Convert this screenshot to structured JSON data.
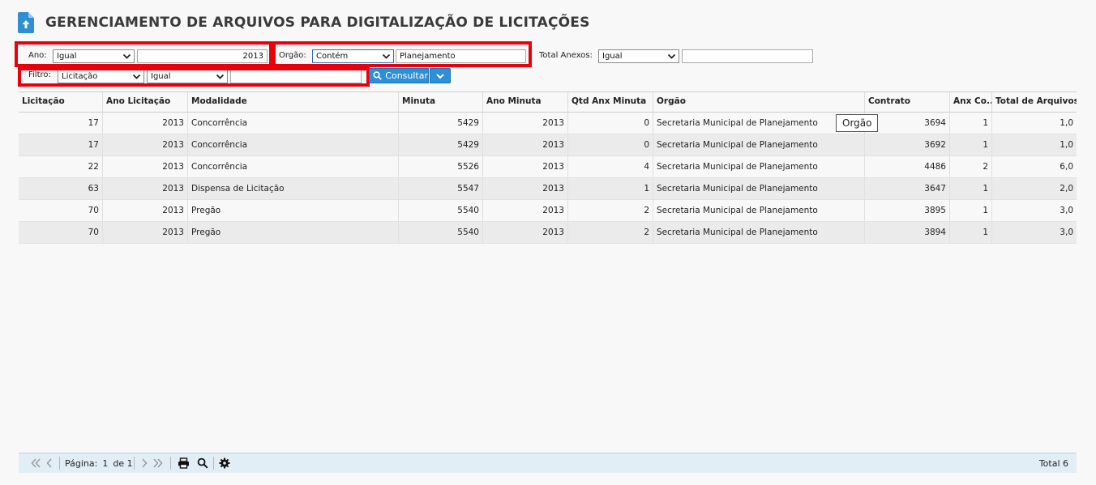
{
  "page": {
    "title": "GERENCIAMENTO DE ARQUIVOS PARA DIGITALIZAÇÃO DE LICITAÇÕES"
  },
  "filters": {
    "ano": {
      "label": "Ano:",
      "operator": "Igual",
      "value": "2013"
    },
    "orgao": {
      "label": "Orgão:",
      "operator": "Contém",
      "value": "Planejamento"
    },
    "total_anexos": {
      "label": "Total Anexos:",
      "operator": "Igual",
      "value": ""
    },
    "filtro": {
      "label": "Filtro:",
      "field": "Licitação",
      "operator": "Igual",
      "value": ""
    },
    "consultar_label": "Consultar"
  },
  "grid": {
    "columns": [
      "Licitação",
      "Ano Licitação",
      "Modalidade",
      "Minuta",
      "Ano Minuta",
      "Qtd Anx Minuta",
      "Orgão",
      "Contrato",
      "Anx Co...",
      "Total de Arquivos"
    ],
    "rows": [
      [
        "17",
        "2013",
        "Concorrência",
        "5429",
        "2013",
        "0",
        "Secretaria Municipal de Planejamento",
        "3694",
        "1",
        "1,0"
      ],
      [
        "17",
        "2013",
        "Concorrência",
        "5429",
        "2013",
        "0",
        "Secretaria Municipal de Planejamento",
        "3692",
        "1",
        "1,0"
      ],
      [
        "22",
        "2013",
        "Concorrência",
        "5526",
        "2013",
        "4",
        "Secretaria Municipal de Planejamento",
        "4486",
        "2",
        "6,0"
      ],
      [
        "63",
        "2013",
        "Dispensa de Licitação",
        "5547",
        "2013",
        "1",
        "Secretaria Municipal de Planejamento",
        "3647",
        "1",
        "2,0"
      ],
      [
        "70",
        "2013",
        "Pregão",
        "5540",
        "2013",
        "2",
        "Secretaria Municipal de Planejamento",
        "3895",
        "1",
        "3,0"
      ],
      [
        "70",
        "2013",
        "Pregão",
        "5540",
        "2013",
        "2",
        "Secretaria Municipal de Planejamento",
        "3894",
        "1",
        "3,0"
      ]
    ]
  },
  "tooltip": "Orgão",
  "footer": {
    "page_label": "Página:",
    "page_current": "1",
    "page_of": "de 1",
    "total": "Total 6"
  },
  "colors": {
    "accent": "#2e8fd6",
    "highlight": "#e8000d",
    "footer_bg": "#e2eef6"
  },
  "icons": [
    "document-upload-icon",
    "search-icon",
    "chevron-down-icon",
    "first-page-icon",
    "prev-page-icon",
    "next-page-icon",
    "last-page-icon",
    "print-icon",
    "gear-icon"
  ]
}
